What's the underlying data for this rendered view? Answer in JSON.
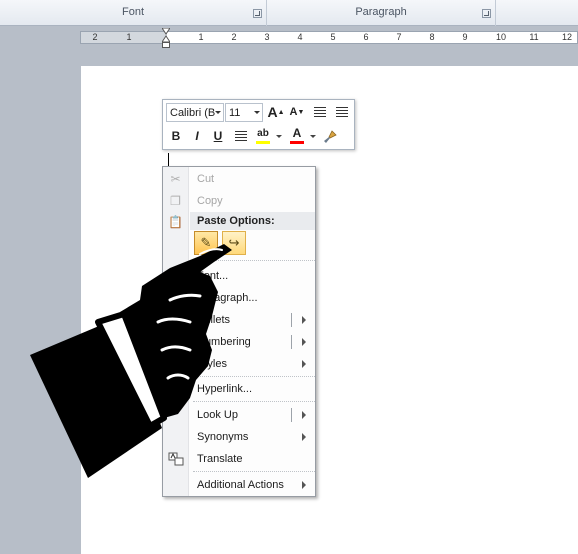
{
  "ribbon": {
    "groups": [
      {
        "label": "Font"
      },
      {
        "label": "Paragraph"
      }
    ]
  },
  "ruler": {
    "numbers": [
      "2",
      "1",
      "1",
      "2",
      "3",
      "4",
      "5",
      "6",
      "7",
      "8",
      "9",
      "10",
      "11",
      "12"
    ]
  },
  "mini_toolbar": {
    "font_name": "Calibri (B",
    "font_size": "11",
    "grow_font_label": "A",
    "shrink_font_label": "A",
    "bold_label": "B",
    "italic_label": "I",
    "underline_label": "U",
    "font_color_label": "A",
    "highlight_label": "ab",
    "highlight_color": "#ffff00",
    "font_color": "#ff0000"
  },
  "context_menu": {
    "items": [
      {
        "label": "Cut",
        "icon": "scissors-icon",
        "disabled": true
      },
      {
        "label": "Copy",
        "icon": "copy-icon",
        "disabled": true
      },
      {
        "label": "Paste Options:",
        "icon": "clipboard-icon",
        "heading": true
      },
      {
        "label": "Font...",
        "icon": "font-icon"
      },
      {
        "label": "Paragraph...",
        "icon": "paragraph-icon"
      },
      {
        "label": "Bullets",
        "icon": "bullets-icon",
        "submenu": true
      },
      {
        "label": "Numbering",
        "icon": "numbering-icon",
        "submenu": true
      },
      {
        "label": "Styles",
        "icon": "styles-icon",
        "submenu": true
      },
      {
        "label": "Hyperlink...",
        "icon": "hyperlink-icon"
      },
      {
        "label": "Look Up",
        "icon": "lookup-icon",
        "submenu": true
      },
      {
        "label": "Synonyms",
        "icon": "synonyms-icon",
        "submenu": true
      },
      {
        "label": "Translate",
        "icon": "translate-icon"
      },
      {
        "label": "Additional Actions",
        "icon": "actions-icon",
        "submenu": true
      }
    ]
  }
}
